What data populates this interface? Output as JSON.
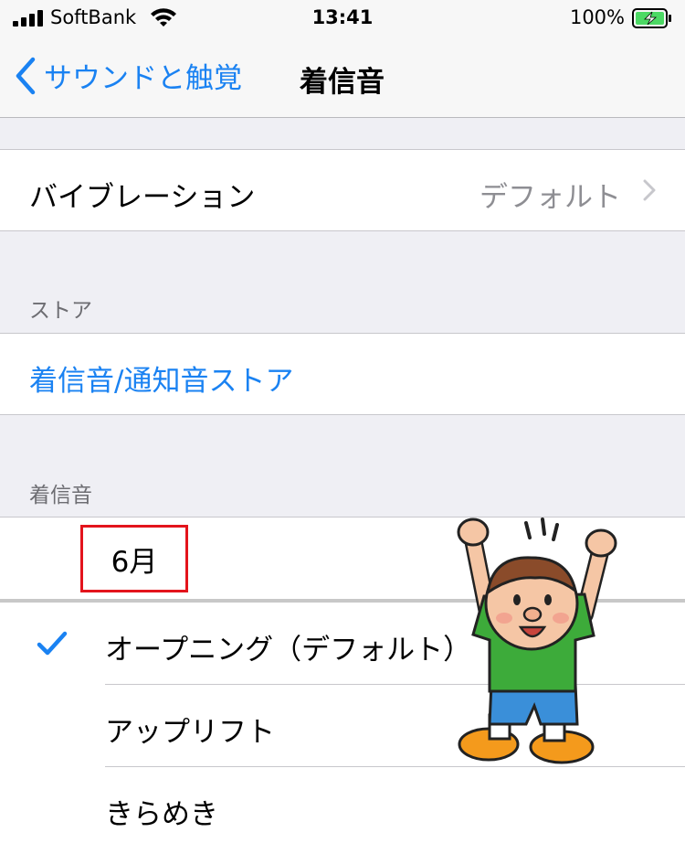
{
  "status_bar": {
    "carrier": "SoftBank",
    "time": "13:41",
    "battery_percent": "100%",
    "battery_level": 1.0,
    "signal_bars": 4
  },
  "nav": {
    "back_label": "サウンドと触覚",
    "title": "着信音",
    "accent_color": "#1a82f2"
  },
  "vibration": {
    "label": "バイブレーション",
    "value": "デフォルト"
  },
  "store_section": {
    "header": "ストア",
    "link_label": "着信音/通知音ストア"
  },
  "ringtones_section": {
    "header": "着信音",
    "highlighted_item": "6月",
    "items": [
      {
        "label": "オープニング（デフォルト）",
        "selected": true
      },
      {
        "label": "アップリフト",
        "selected": false
      },
      {
        "label": "きらめき",
        "selected": false
      }
    ]
  }
}
